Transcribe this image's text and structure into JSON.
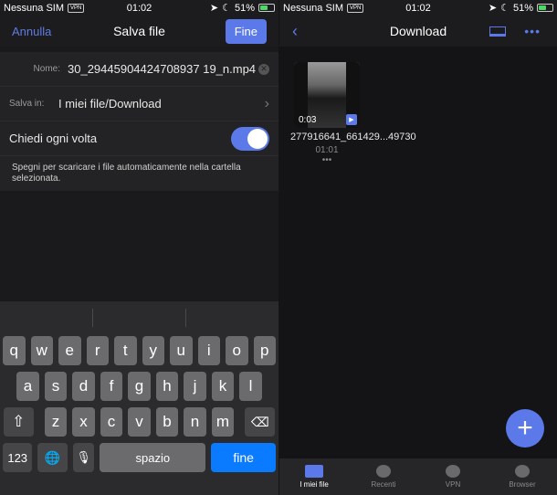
{
  "status": {
    "carrier": "Nessuna SIM",
    "vpn": "VPN",
    "time": "01:02",
    "battery": "51%"
  },
  "save": {
    "title": "Salva file",
    "cancel": "Annulla",
    "done": "Fine",
    "name_label": "Nome:",
    "name_value": "30_29445904424708937 19_n.mp4",
    "dest_label": "Salva in:",
    "dest_value": "I miei file/Download",
    "ask_label": "Chiedi ogni volta",
    "ask_on": true,
    "hint": "Spegni per scaricare i file automaticamente nella cartella selezionata."
  },
  "keyboard": {
    "row1": [
      "q",
      "w",
      "e",
      "r",
      "t",
      "y",
      "u",
      "i",
      "o",
      "p"
    ],
    "row2": [
      "a",
      "s",
      "d",
      "f",
      "g",
      "h",
      "j",
      "k",
      "l"
    ],
    "row3": [
      "z",
      "x",
      "c",
      "v",
      "b",
      "n",
      "m"
    ],
    "num": "123",
    "space": "spazio",
    "done": "fine"
  },
  "download": {
    "title": "Download",
    "file": {
      "name": "277916641_661429...49730",
      "duration": "0:03",
      "time": "01:01"
    }
  },
  "tabs": [
    {
      "label": "I miei file"
    },
    {
      "label": "Recenti"
    },
    {
      "label": "VPN"
    },
    {
      "label": "Browser"
    }
  ]
}
